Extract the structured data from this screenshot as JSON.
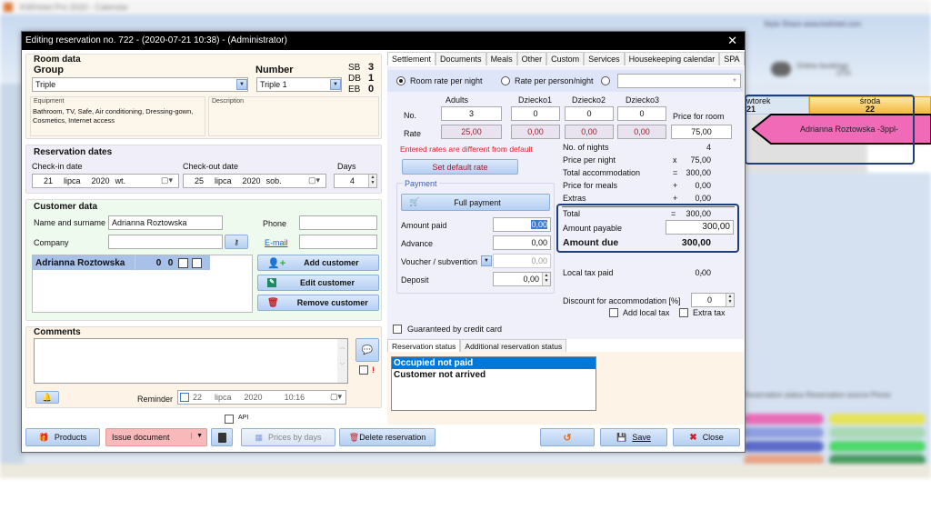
{
  "background_app": {
    "title": "KWHotel Pro 2020 - Calendar",
    "ribbon_tabs": "Style  Share  www.kwhotel.com",
    "online_bookings": "Online bookings",
    "ota_label": "OTA",
    "calendar": {
      "day1_name": "wtorek",
      "day1_num": "21",
      "day2_name": "środa",
      "day2_num": "22",
      "reservation_label": "Adrianna Roztowska -3ppl-",
      "reservation_color": "#f06ab8"
    },
    "legend_tabs": "Reservation status   Reservation source   Prices"
  },
  "dialog": {
    "title": "Editing reservation no. 722 - (2020-07-21 10:38) - (Administrator)",
    "close_glyph": "✕"
  },
  "room_data": {
    "section_title": "Room data",
    "group_label": "Group",
    "group_value": "Triple",
    "number_label": "Number",
    "number_value": "Triple 1",
    "beds": [
      {
        "label": "SB",
        "value": "3"
      },
      {
        "label": "DB",
        "value": "1"
      },
      {
        "label": "EB",
        "value": "0"
      }
    ],
    "equipment_label": "Equipment",
    "equipment_value": "Bathroom, TV, Safe, Air conditioning, Dressing-gown, Cosmetics, Internet access",
    "description_label": "Description",
    "description_value": ""
  },
  "reservation_dates": {
    "section_title": "Reservation dates",
    "checkin_label": "Check-in date",
    "checkin": {
      "day": "21",
      "month": "lipca",
      "year": "2020",
      "weekday": "wt."
    },
    "checkout_label": "Check-out date",
    "checkout": {
      "day": "25",
      "month": "lipca",
      "year": "2020",
      "weekday": "sob."
    },
    "days_label": "Days",
    "days_value": "4"
  },
  "customer_data": {
    "section_title": "Customer data",
    "name_label": "Name and surname",
    "name_value": "Adrianna Roztowska",
    "company_label": "Company",
    "company_value": "",
    "phone_label": "Phone",
    "phone_value": "",
    "email_label": "E-mail",
    "email_value": "",
    "customers": [
      {
        "name": "Adrianna Roztowska",
        "col1": "0",
        "col2": "0"
      }
    ],
    "add_customer": "Add customer",
    "edit_customer": "Edit customer",
    "remove_customer": "Remove customer"
  },
  "comments": {
    "section_title": "Comments",
    "value": "",
    "reminder_label": "Reminder",
    "reminder": {
      "day": "22",
      "month": "lipca",
      "year": "2020",
      "time": "10:16"
    },
    "important_mark": "!"
  },
  "bottom_bar": {
    "api_label": "API",
    "products": "Products",
    "issue_document": "Issue document",
    "prices_by_days": "Prices by days",
    "delete_reservation": "Delete reservation",
    "save": "Save",
    "close": "Close"
  },
  "tabs": [
    "Settlement",
    "Documents",
    "Meals",
    "Other",
    "Custom",
    "Services",
    "Housekeeping calendar",
    "SPA"
  ],
  "settlement": {
    "rate_mode_room": "Room rate per night",
    "rate_mode_person": "Rate per person/night",
    "rate_mode_custom_value": "",
    "columns": [
      "Adults",
      "Dziecko1",
      "Dziecko2",
      "Dziecko3"
    ],
    "no_label": "No.",
    "rate_label": "Rate",
    "counts": [
      "3",
      "0",
      "0",
      "0"
    ],
    "rates": [
      "25,00",
      "0,00",
      "0,00",
      "0,00"
    ],
    "price_for_room_label": "Price for room",
    "price_for_room": "75,00",
    "warning": "Entered rates are different from default",
    "set_default_rate": "Set default rate",
    "payment_group": "Payment",
    "full_payment": "Full payment",
    "amount_paid_label": "Amount paid",
    "amount_paid": "0,00",
    "advance_label": "Advance",
    "advance": "0,00",
    "voucher_label": "Voucher / subvention",
    "voucher": "0,00",
    "deposit_label": "Deposit",
    "deposit": "0,00",
    "summary": [
      {
        "label": "No. of nights",
        "op": "",
        "value": "4"
      },
      {
        "label": "Price per night",
        "op": "x",
        "value": "75,00"
      },
      {
        "label": "Total accommodation",
        "op": "=",
        "value": "300,00"
      },
      {
        "label": "Price for meals",
        "op": "+",
        "value": "0,00"
      },
      {
        "label": "Extras",
        "op": "+",
        "value": "0,00"
      }
    ],
    "total_label": "Total",
    "total_op": "=",
    "total": "300,00",
    "amount_payable_label": "Amount payable",
    "amount_payable": "300,00",
    "amount_due_label": "Amount due",
    "amount_due": "300,00",
    "local_tax_label": "Local tax paid",
    "local_tax_op": "-",
    "local_tax": "0,00",
    "discount_label": "Discount for accommodation [%]",
    "discount": "0",
    "add_local_tax": "Add local tax",
    "extra_tax": "Extra tax",
    "guaranteed_label": "Guaranteed by credit card"
  },
  "status_tabs": [
    "Reservation status",
    "Additional reservation status"
  ],
  "statuses": [
    "Occupied not paid",
    "Customer not arrived"
  ],
  "colors": {
    "accent": "#1f3f7a",
    "warning": "#e0202a",
    "selected": "#0078d7",
    "issue_document_bg": "#f7b9b9"
  }
}
